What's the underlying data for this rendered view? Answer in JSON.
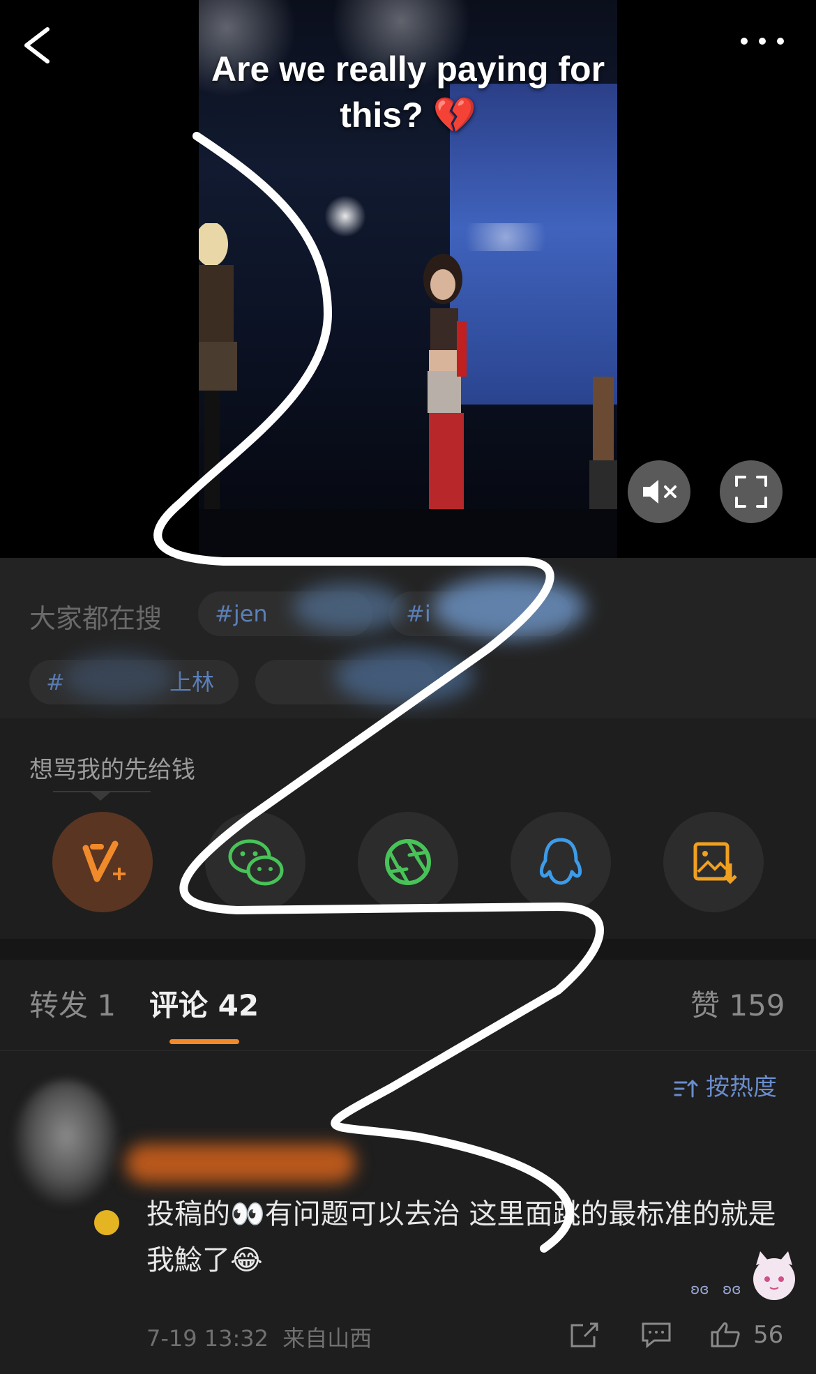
{
  "video": {
    "overlay_caption_line1": "Are we really paying for",
    "overlay_caption_line2": "this? 💔"
  },
  "hot_search": {
    "label": "大家都在搜",
    "tags": [
      "#jen",
      "#i",
      "#",
      "上林"
    ]
  },
  "post": {
    "caption": "想骂我的先给钱"
  },
  "share": {
    "targets": [
      "weibo-vplus",
      "wechat",
      "moments",
      "qq",
      "save-image"
    ]
  },
  "tabs": {
    "repost": "转发 1",
    "comments": "评论 42",
    "likes": "赞 159"
  },
  "sort": {
    "label": "按热度"
  },
  "comment": {
    "text": "投稿的👀有问题可以去治 这里面跳的最标准的就是我鯰了😂",
    "timestamp": "7-19 13:32",
    "location": "来自山西",
    "like_count": "56"
  },
  "colors": {
    "accent_orange": "#f08a2b",
    "link_blue": "#5b7fb8",
    "wechat_green": "#48c358",
    "qq_blue": "#3d9be9",
    "save_orange": "#f0a020"
  }
}
